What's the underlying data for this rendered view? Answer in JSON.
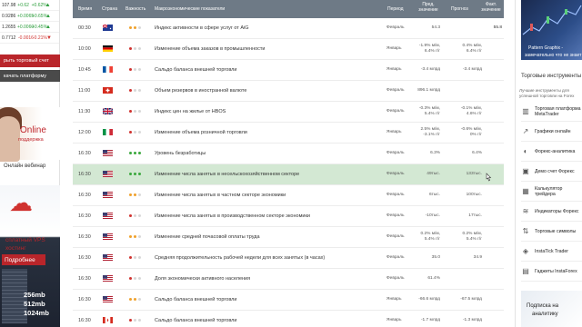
{
  "ticker": [
    {
      "price": "107.98",
      "change": "+0.62",
      "pct": "+0.62%",
      "dir": "up"
    },
    {
      "price": "0.9286",
      "change": "+0.0065",
      "pct": "+0.65%",
      "dir": "up"
    },
    {
      "price": "1.2655",
      "change": "+0.0060",
      "pct": "+0.45%",
      "dir": "up"
    },
    {
      "price": "0.7712",
      "change": "-0.0016",
      "pct": "-0.21%",
      "dir": "down"
    }
  ],
  "left": {
    "open_account": "рыть торговый счет",
    "download_platform": "качать платформу",
    "support_title": "Online",
    "support_sub": "поддержка",
    "webinar": "Онлайн вебинар",
    "vps_line1": "сплатный VPS",
    "vps_line2": "хостинг",
    "vps_more": "Подробнее",
    "mem": [
      "256mb",
      "512mb",
      "1024mb"
    ]
  },
  "table": {
    "headers": {
      "time": "Время",
      "country": "Страна",
      "importance": "Важность",
      "indicator": "Макроэкономические показатели",
      "period": "Период",
      "prev": "Пред. значение",
      "forecast": "Прогноз",
      "actual": "Факт. значение"
    },
    "rows": [
      {
        "time": "00:30",
        "flag": "au",
        "imp": 2,
        "name": "Индекс активности в сфере услуг от AiG",
        "period": "Февраль",
        "prev": "54.3",
        "forecast": "",
        "actual": "55.8"
      },
      {
        "time": "10:00",
        "flag": "de",
        "imp": 1,
        "name": "Изменение объема заказов в промышленности",
        "period": "Январь",
        "prev": "-1.9% м/м, 6.4% г/г",
        "forecast": "0.4% м/м, 6.4% г/г",
        "actual": ""
      },
      {
        "time": "10:45",
        "flag": "fr",
        "imp": 1,
        "name": "Сальдо баланса внешней торговли",
        "period": "Январь",
        "prev": "-3.4 млрд",
        "forecast": "-3.4 млрд",
        "actual": ""
      },
      {
        "time": "11:00",
        "flag": "ch",
        "imp": 1,
        "name": "Объем резервов в иностранной валюте",
        "period": "Февраль",
        "prev": "896.1 млрд",
        "forecast": "",
        "actual": ""
      },
      {
        "time": "11:30",
        "flag": "gb",
        "imp": 1,
        "name": "Индекс цен на жилье от HBOS",
        "period": "Февраль",
        "prev": "-0.3% м/м, 5.4% г/г",
        "forecast": "-0.1% м/м, 4.6% г/г",
        "actual": ""
      },
      {
        "time": "12:00",
        "flag": "it",
        "imp": 1,
        "name": "Изменение объема розничной торговли",
        "period": "Январь",
        "prev": "2.5% м/м, -3.1% г/г",
        "forecast": "-0.6% м/м, 0% г/г",
        "actual": ""
      },
      {
        "time": "16:30",
        "flag": "us",
        "imp": 3,
        "name": "Уровень безработицы",
        "period": "Февраль",
        "prev": "6.3%",
        "forecast": "6.4%",
        "actual": ""
      },
      {
        "time": "16:30",
        "flag": "us",
        "imp": 3,
        "name": "Изменение числа занятых в несельскохозяйственном секторе",
        "period": "Февраль",
        "prev": "49тыс.",
        "forecast": "133тыс.",
        "actual": ""
      },
      {
        "time": "16:30",
        "flag": "us",
        "imp": 2,
        "name": "Изменение числа занятых в частном секторе экономики",
        "period": "Февраль",
        "prev": "6тыс.",
        "forecast": "100тыс.",
        "actual": ""
      },
      {
        "time": "16:30",
        "flag": "us",
        "imp": 1,
        "name": "Изменение числа занятых в производственном секторе экономики",
        "period": "Февраль",
        "prev": "-10тыс.",
        "forecast": "17тыс.",
        "actual": ""
      },
      {
        "time": "16:30",
        "flag": "us",
        "imp": 2,
        "name": "Изменение средней почасовой оплаты труда",
        "period": "Февраль",
        "prev": "0.2% м/м, 5.4% г/г",
        "forecast": "0.2% м/м, 5.4% г/г",
        "actual": ""
      },
      {
        "time": "16:30",
        "flag": "us",
        "imp": 1,
        "name": "Средняя продолжительность рабочей недели для всех занятых (в часах)",
        "period": "Февраль",
        "prev": "35.0",
        "forecast": "34.9",
        "actual": ""
      },
      {
        "time": "16:30",
        "flag": "us",
        "imp": 1,
        "name": "Доля экономически активного населения",
        "period": "Февраль",
        "prev": "61.4%",
        "forecast": "",
        "actual": ""
      },
      {
        "time": "16:30",
        "flag": "us",
        "imp": 2,
        "name": "Сальдо баланса внешней торговли",
        "period": "Январь",
        "prev": "-66.6 млрд",
        "forecast": "-67.5 млрд",
        "actual": ""
      },
      {
        "time": "16:30",
        "flag": "ca",
        "imp": 1,
        "name": "Сальдо баланса внешней торговли",
        "period": "Январь",
        "prev": "-1.7 млрд",
        "forecast": "-1.3 млрд",
        "actual": ""
      }
    ]
  },
  "right": {
    "book_line1": "Pattern Graphix -",
    "book_line2": "замечательно что не знает",
    "tools_heading": "Торговые инструменты",
    "tools_sub": "Лучшие инструменты для успешной торговли на Forex",
    "tools": [
      {
        "icon": "chart-icon",
        "label": "Торговая платформа MetaTrader"
      },
      {
        "icon": "graph-icon",
        "label": "Графики онлайн"
      },
      {
        "icon": "analytics-icon",
        "label": "Форекс-аналитика"
      },
      {
        "icon": "demo-icon",
        "label": "Демо счет Форекс"
      },
      {
        "icon": "calculator-icon",
        "label": "Калькулятор трейдера"
      },
      {
        "icon": "indicator-icon",
        "label": "Индикаторы Форекс"
      },
      {
        "icon": "symbols-icon",
        "label": "Торговые символы"
      },
      {
        "icon": "instatick-icon",
        "label": "InstaTick Trader"
      },
      {
        "icon": "gadget-icon",
        "label": "Гаджеты InstaForex"
      }
    ],
    "banner_line1": "Подписка на",
    "banner_line2": "аналитику"
  }
}
